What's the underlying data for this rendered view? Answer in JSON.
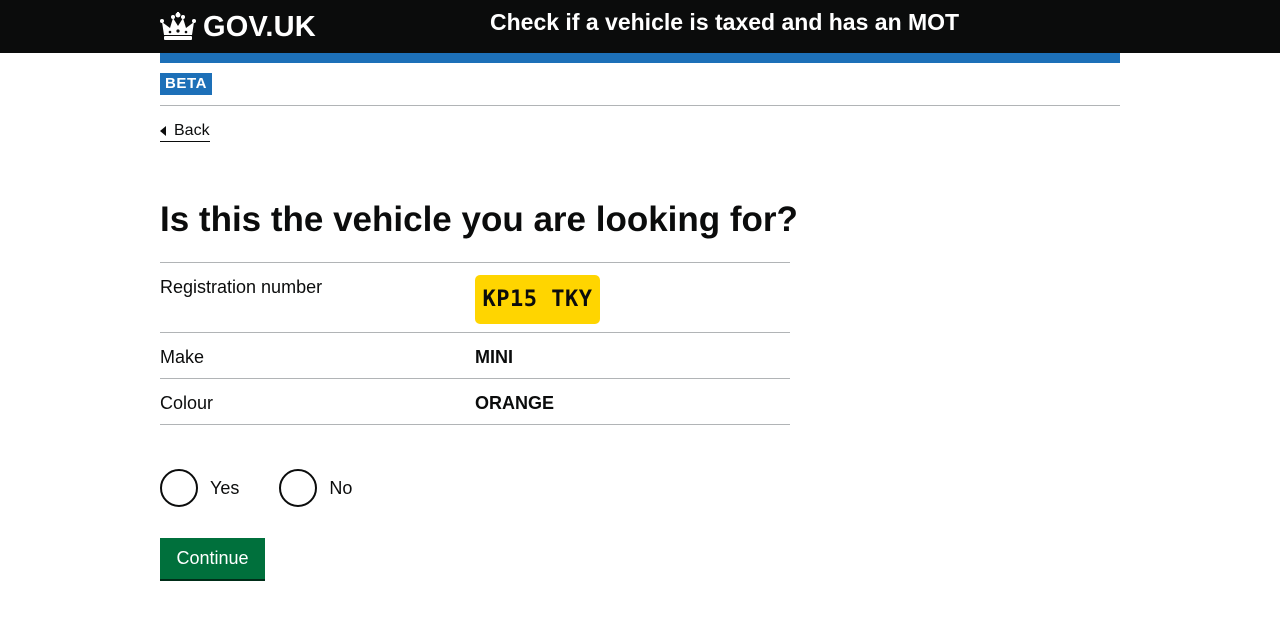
{
  "header": {
    "logo_text": "GOV.UK",
    "service_name": "Check if a vehicle is taxed and has an MOT"
  },
  "phase_banner": {
    "tag": "BETA"
  },
  "back_link": {
    "label": "Back"
  },
  "main": {
    "title": "Is this the vehicle you are looking for?",
    "summary": [
      {
        "key": "Registration number",
        "value": "KP15 TKY"
      },
      {
        "key": "Make",
        "value": "MINI"
      },
      {
        "key": "Colour",
        "value": "ORANGE"
      }
    ],
    "radios": [
      {
        "label": "Yes",
        "selected": false
      },
      {
        "label": "No",
        "selected": false
      }
    ],
    "continue_label": "Continue"
  },
  "colors": {
    "header_bg": "#0b0c0c",
    "brand_blue": "#1d70b8",
    "plate_yellow": "#ffd500",
    "button_green": "#00703c"
  },
  "icons": [
    "crown-icon",
    "back-arrow-icon"
  ]
}
